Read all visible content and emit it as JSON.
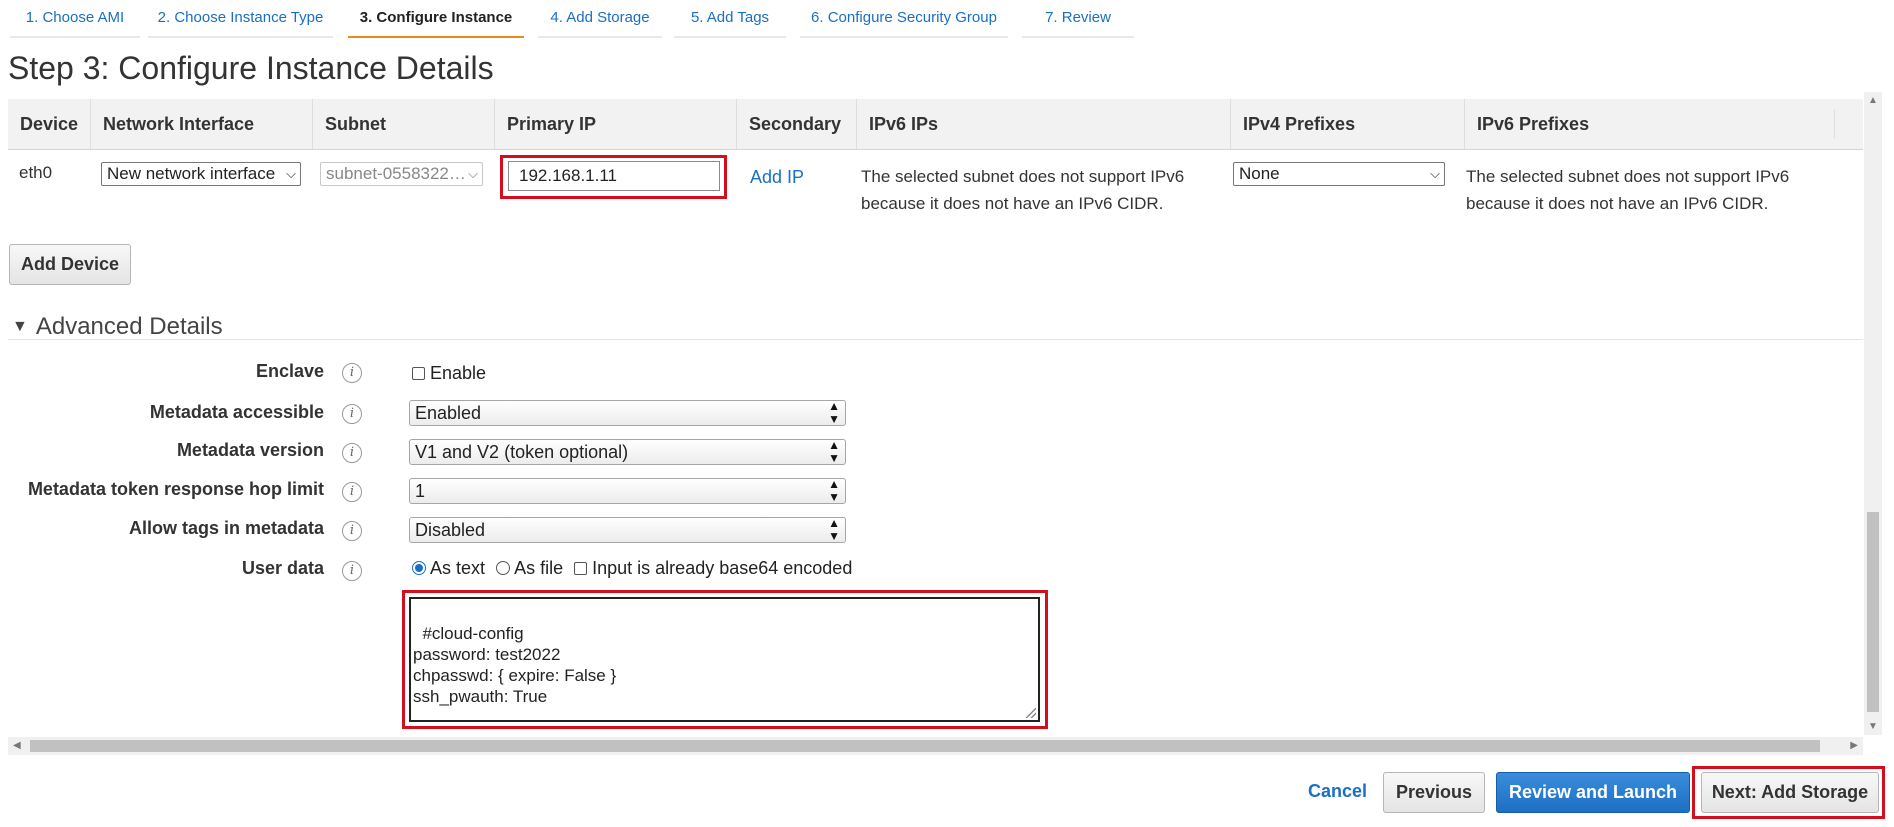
{
  "wizard": {
    "steps": [
      {
        "label": "1. Choose AMI"
      },
      {
        "label": "2. Choose Instance Type"
      },
      {
        "label": "3. Configure Instance"
      },
      {
        "label": "4. Add Storage"
      },
      {
        "label": "5. Add Tags"
      },
      {
        "label": "6. Configure Security Group"
      },
      {
        "label": "7. Review"
      }
    ],
    "active_index": 2
  },
  "page": {
    "title": "Step 3: Configure Instance Details"
  },
  "network_table": {
    "headers": [
      "Device",
      "Network Interface",
      "Subnet",
      "Primary IP",
      "Secondary",
      "IPv6 IPs",
      "IPv4 Prefixes",
      "IPv6 Prefixes"
    ],
    "row": {
      "device": "eth0",
      "network_interface": "New network interface",
      "subnet": "subnet-0558322…",
      "primary_ip": "192.168.1.11",
      "secondary_link": "Add IP",
      "ipv6_msg_line1": "The selected subnet does not support IPv6",
      "ipv6_msg_line2": "because it does not have an IPv6 CIDR.",
      "ipv4_prefixes": "None",
      "ipv6_prefix_msg_line1": "The selected subnet does not support IPv6",
      "ipv6_prefix_msg_line2": "because it does not have an IPv6 CIDR."
    },
    "add_device_label": "Add Device"
  },
  "advanced": {
    "heading": "Advanced Details",
    "enclave": {
      "label": "Enclave",
      "option": "Enable",
      "checked": false
    },
    "metadata_accessible": {
      "label": "Metadata accessible",
      "value": "Enabled"
    },
    "metadata_version": {
      "label": "Metadata version",
      "value": "V1 and V2 (token optional)"
    },
    "hop_limit": {
      "label": "Metadata token response hop limit",
      "value": "1"
    },
    "tags_in_metadata": {
      "label": "Allow tags in metadata",
      "value": "Disabled"
    },
    "user_data": {
      "label": "User data",
      "as_text": "As text",
      "as_file": "As file",
      "base64": "Input is already base64 encoded",
      "content": "#cloud-config\npassword: test2022\nchpasswd: { expire: False }\nssh_pwauth: True"
    }
  },
  "footer": {
    "cancel": "Cancel",
    "previous": "Previous",
    "review_launch": "Review and Launch",
    "next": "Next: Add Storage"
  },
  "colors": {
    "accent": "#1a6fc4",
    "active_tab_underline": "#e8891e",
    "highlight": "#d40f1d"
  }
}
